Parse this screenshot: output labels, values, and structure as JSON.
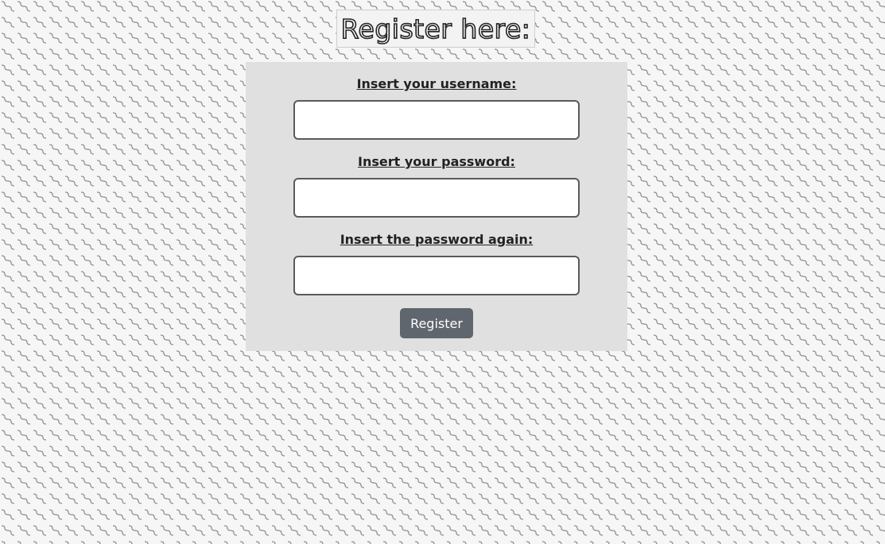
{
  "page": {
    "title": "Register here:",
    "background_color": "#f6f6f6",
    "panel_color": "#e0e0e0",
    "button_color": "#5f666d"
  },
  "form": {
    "username_label": "Insert your username:",
    "username_value": "",
    "password_label": "Insert your password:",
    "password_value": "",
    "password_again_label": "Insert the password again:",
    "password_again_value": "",
    "submit_label": "Register"
  }
}
